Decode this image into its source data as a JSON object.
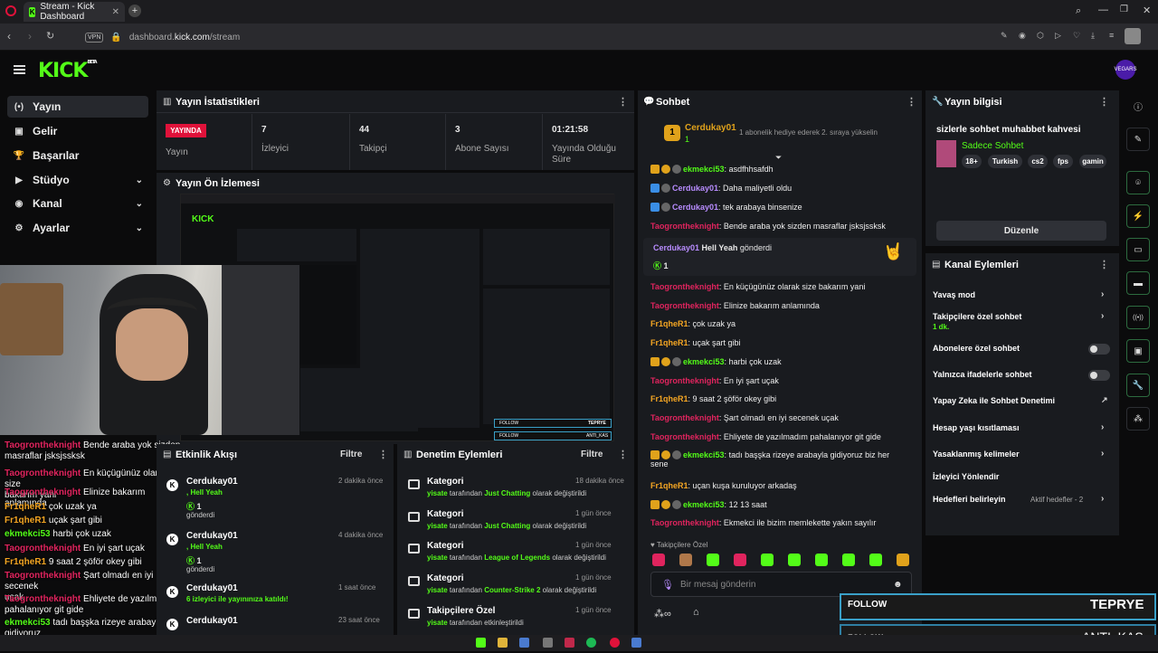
{
  "browser": {
    "tab_title": "Stream - Kick Dashboard",
    "url_host": "dashboard.",
    "url_domain": "kick.com",
    "url_path": "/stream",
    "vpn": "VPN"
  },
  "brand": {
    "logo": "KICK",
    "beta": "BETA",
    "avatar": "VEGARS"
  },
  "nav": [
    {
      "label": "Yayın",
      "icon": "(•)"
    },
    {
      "label": "Gelir",
      "icon": "▣"
    },
    {
      "label": "Başarılar",
      "icon": "🏆"
    },
    {
      "label": "Stüdyo",
      "icon": "▶"
    },
    {
      "label": "Kanal",
      "icon": "◉"
    },
    {
      "label": "Ayarlar",
      "icon": "⚙"
    }
  ],
  "stats": {
    "title": "Yayın İstatistikleri",
    "live_badge": "YAYINDA",
    "live_label": "Yayın",
    "items": [
      {
        "value": "7",
        "label": "İzleyici"
      },
      {
        "value": "44",
        "label": "Takipçi"
      },
      {
        "value": "3",
        "label": "Abone Sayısı"
      },
      {
        "value": "01:21:58",
        "label": "Yayında Olduğu Süre"
      }
    ]
  },
  "preview": {
    "title": "Yayın Ön İzlemesi"
  },
  "activity": {
    "title": "Etkinlik Akışı",
    "filter": "Filtre",
    "items": [
      {
        "user": "Cerdukay01",
        "line1": ", Hell Yeah",
        "count": "1",
        "line2": "gönderdi",
        "time": "2 dakika önce"
      },
      {
        "user": "Cerdukay01",
        "line1": ", Hell Yeah",
        "count": "1",
        "line2": "gönderdi",
        "time": "4 dakika önce"
      },
      {
        "user": "Cerdukay01",
        "line1": "6 izleyici ile yayınınıza katıldı!",
        "time": "1 saat önce"
      },
      {
        "user": "Cerdukay01",
        "time": "23 saat önce"
      }
    ]
  },
  "moderation": {
    "title": "Denetim Eylemleri",
    "filter": "Filtre",
    "items": [
      {
        "title": "Kategori",
        "user": "yisate",
        "mid": "tarafından",
        "value": "Just Chatting",
        "tail": "olarak değiştirildi",
        "time": "18 dakika önce"
      },
      {
        "title": "Kategori",
        "user": "yisate",
        "mid": "tarafından",
        "value": "Just Chatting",
        "tail": "olarak değiştirildi",
        "time": "1 gün önce"
      },
      {
        "title": "Kategori",
        "user": "yisate",
        "mid": "tarafından",
        "value": "League of Legends",
        "tail": "olarak değiştirildi",
        "time": "1 gün önce"
      },
      {
        "title": "Kategori",
        "user": "yisate",
        "mid": "tarafından",
        "value": "Counter-Strike 2",
        "tail": "olarak değiştirildi",
        "time": "1 gün önce"
      },
      {
        "title": "Takipçilere Özel",
        "user": "yisate",
        "mid": "tarafından etkinleştirildi",
        "value": "",
        "tail": "",
        "time": "1 gün önce"
      }
    ]
  },
  "chat": {
    "title": "Sohbet",
    "pinned": {
      "user": "Cerdukay01",
      "count": "1",
      "text": "1 abonelik hediye ederek 2. sıraya yükselin"
    },
    "messages": [
      {
        "user": "ekmekci53",
        "color": "#53fc18",
        "badges": "crown",
        "text": "asdfhhsafdh"
      },
      {
        "user": "Cerdukay01",
        "color": "#b88cff",
        "badges": "vip",
        "text": "Daha maliyetli oldu"
      },
      {
        "user": "Cerdukay01",
        "color": "#b88cff",
        "badges": "vip",
        "text": "tek arabaya binsenize"
      },
      {
        "user": "Taogrontheknight",
        "color": "#e0245e",
        "badges": "",
        "text": "Bende araba yok sizden masraflar jsksjssksk"
      },
      {
        "user": "Taogrontheknight",
        "color": "#e0245e",
        "badges": "",
        "text": "En küçügünüz olarak size bakarım yani"
      },
      {
        "user": "Taogrontheknight",
        "color": "#e0245e",
        "badges": "",
        "text": "Elinize bakarım anlamında"
      },
      {
        "user": "Fr1qheR1",
        "color": "#f5a623",
        "badges": "",
        "text": "çok uzak ya"
      },
      {
        "user": "Fr1qheR1",
        "color": "#f5a623",
        "badges": "",
        "text": "uçak şart gibi"
      },
      {
        "user": "ekmekci53",
        "color": "#53fc18",
        "badges": "crown",
        "text": "harbi çok uzak"
      },
      {
        "user": "Taogrontheknight",
        "color": "#e0245e",
        "badges": "",
        "text": "En iyi şart uçak"
      },
      {
        "user": "Fr1qheR1",
        "color": "#f5a623",
        "badges": "",
        "text": "9 saat 2 şöför okey gibi"
      },
      {
        "user": "Taogrontheknight",
        "color": "#e0245e",
        "badges": "",
        "text": "Şart olmadı en iyi secenek uçak"
      },
      {
        "user": "Taogrontheknight",
        "color": "#e0245e",
        "badges": "",
        "text": "Ehliyete de yazılmadım pahalanıyor git gide"
      },
      {
        "user": "ekmekci53",
        "color": "#53fc18",
        "badges": "crown",
        "text": "tadı başşka rizeye arabayla gidiyoruz biz her",
        "text2": "sene"
      },
      {
        "user": "Fr1qheR1",
        "color": "#f5a623",
        "badges": "",
        "text": "uçan kuşa kuruluyor arkadaş"
      },
      {
        "user": "ekmekci53",
        "color": "#53fc18",
        "badges": "crown",
        "text": "12 13 saat"
      },
      {
        "user": "Taogrontheknight",
        "color": "#e0245e",
        "badges": "",
        "text": "Ekmekci ile bizim memlekette yakın sayılır"
      }
    ],
    "gift": {
      "user": "Cerdukay01",
      "item": "Hell Yeah",
      "verb": "gönderdi",
      "count": "1"
    },
    "followers_only": "Takipçilere Özel",
    "input_placeholder": "Bir mesaj gönderin"
  },
  "info": {
    "title": "Yayın bilgisi",
    "stream_title": "sizlerle sohbet muhabbet kahvesi",
    "category": "Sadece Sohbet",
    "tags": [
      "18+",
      "Turkish",
      "cs2",
      "fps",
      "gamin"
    ],
    "edit": "Düzenle"
  },
  "channel_actions": {
    "title": "Kanal Eylemleri",
    "items": [
      {
        "label": "Yavaş mod",
        "kind": "arrow"
      },
      {
        "label": "Takipçilere özel sohbet",
        "sub": "1 dk.",
        "kind": "arrow"
      },
      {
        "label": "Abonelere özel sohbet",
        "kind": "toggle"
      },
      {
        "label": "Yalnızca ifadelerle sohbet",
        "kind": "toggle"
      },
      {
        "label": "Yapay Zeka ile Sohbet Denetimi",
        "kind": "ext"
      },
      {
        "label": "Hesap yaşı kısıtlaması",
        "kind": "arrow"
      },
      {
        "label": "Yasaklanmış kelimeler",
        "kind": "arrow"
      },
      {
        "label": "İzleyici Yönlendir",
        "kind": "none"
      },
      {
        "label": "Hedefleri belirleyin",
        "sub": "Aktif hedefler - 2",
        "kind": "arrow"
      }
    ]
  },
  "overlay_chat": [
    {
      "user": "Taogrontheknight",
      "color": "#e0245e",
      "text": "Bende araba yok sizden",
      "text2": "masraflar jsksjssksk"
    },
    {
      "user": "Taogrontheknight",
      "color": "#e0245e",
      "text": "En küçügünüz olarak size",
      "text2": "bakarım yani"
    },
    {
      "user": "Taogrontheknight",
      "color": "#e0245e",
      "text": "Elinize bakarım anlamında"
    },
    {
      "user": "Fr1qheR1",
      "color": "#f5a623",
      "text": "çok uzak ya"
    },
    {
      "user": "Fr1qheR1",
      "color": "#f5a623",
      "text": "uçak şart gibi"
    },
    {
      "user": "ekmekci53",
      "color": "#53fc18",
      "text": "harbi çok uzak"
    },
    {
      "user": "Taogrontheknight",
      "color": "#e0245e",
      "text": "En iyi şart uçak"
    },
    {
      "user": "Fr1qheR1",
      "color": "#f5a623",
      "text": "9 saat 2 şöför okey gibi"
    },
    {
      "user": "Taogrontheknight",
      "color": "#e0245e",
      "text": "Şart olmadı en iyi secenek",
      "text2": "uçak"
    },
    {
      "user": "Taogrontheknight",
      "color": "#e0245e",
      "text": "Ehliyete de yazılmadım",
      "text2": "pahalanıyor git gide"
    },
    {
      "user": "ekmekci53",
      "color": "#53fc18",
      "text": "tadı başşka rizeye arabayla gidiyoruz",
      "text2": "biz her sene"
    },
    {
      "user": "Fr1qheR1",
      "color": "#f5a623",
      "text": "uçan kuşa kuruluyor arkadaş"
    }
  ],
  "follow_alerts": [
    {
      "label": "FOLLOW",
      "name": "TEPRYE"
    },
    {
      "label": "FOLLOW",
      "name": "ANTI_KAS"
    }
  ],
  "colors": {
    "accent": "#53fc18",
    "live": "#e0123a",
    "panel": "#191b1f",
    "bg": "#0b0b0c"
  }
}
